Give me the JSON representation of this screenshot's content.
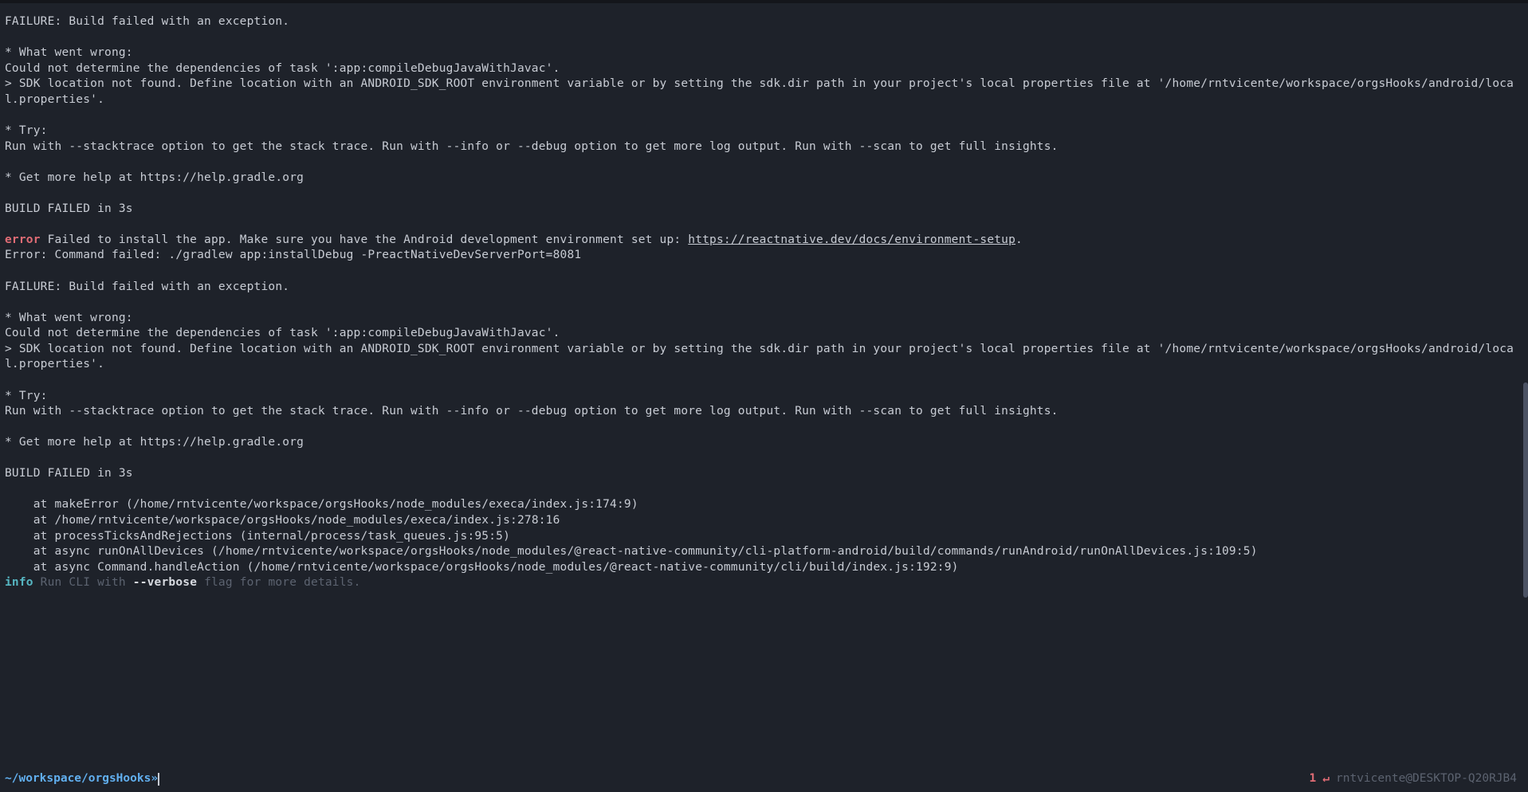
{
  "output": {
    "block1": {
      "failure": "FAILURE: Build failed with an exception.",
      "wrong_header": "* What went wrong:",
      "wrong_line1": "Could not determine the dependencies of task ':app:compileDebugJavaWithJavac'.",
      "wrong_line2": "> SDK location not found. Define location with an ANDROID_SDK_ROOT environment variable or by setting the sdk.dir path in your project's local properties file at '/home/rntvicente/workspace/orgsHooks/android/local.properties'.",
      "try_header": "* Try:",
      "try_line": "Run with --stacktrace option to get the stack trace. Run with --info or --debug option to get more log output. Run with --scan to get full insights.",
      "help_line": "* Get more help at https://help.gradle.org",
      "build_failed": "BUILD FAILED in 3s"
    },
    "error_prefix": "error",
    "error_msg": " Failed to install the app. Make sure you have the Android development environment set up: ",
    "error_link": "https://reactnative.dev/docs/environment-setup",
    "error_suffix": ".",
    "error_cmd": "Error: Command failed: ./gradlew app:installDebug -PreactNativeDevServerPort=8081",
    "block2": {
      "failure": "FAILURE: Build failed with an exception.",
      "wrong_header": "* What went wrong:",
      "wrong_line1": "Could not determine the dependencies of task ':app:compileDebugJavaWithJavac'.",
      "wrong_line2": "> SDK location not found. Define location with an ANDROID_SDK_ROOT environment variable or by setting the sdk.dir path in your project's local properties file at '/home/rntvicente/workspace/orgsHooks/android/local.properties'.",
      "try_header": "* Try:",
      "try_line": "Run with --stacktrace option to get the stack trace. Run with --info or --debug option to get more log output. Run with --scan to get full insights.",
      "help_line": "* Get more help at https://help.gradle.org",
      "build_failed": "BUILD FAILED in 3s"
    },
    "stack": [
      "    at makeError (/home/rntvicente/workspace/orgsHooks/node_modules/execa/index.js:174:9)",
      "    at /home/rntvicente/workspace/orgsHooks/node_modules/execa/index.js:278:16",
      "    at processTicksAndRejections (internal/process/task_queues.js:95:5)",
      "    at async runOnAllDevices (/home/rntvicente/workspace/orgsHooks/node_modules/@react-native-community/cli-platform-android/build/commands/runAndroid/runOnAllDevices.js:109:5)",
      "    at async Command.handleAction (/home/rntvicente/workspace/orgsHooks/node_modules/@react-native-community/cli/build/index.js:192:9)"
    ],
    "info_prefix": "info",
    "info_seg1": " Run CLI with ",
    "info_flag": "--verbose",
    "info_seg2": " flag for more details."
  },
  "prompt": {
    "path": "~/workspace/orgsHooks ",
    "symbol": "»"
  },
  "status": {
    "error_count": "1",
    "return_icon": "↵",
    "user_host": "rntvicente@DESKTOP-Q20RJB4"
  }
}
